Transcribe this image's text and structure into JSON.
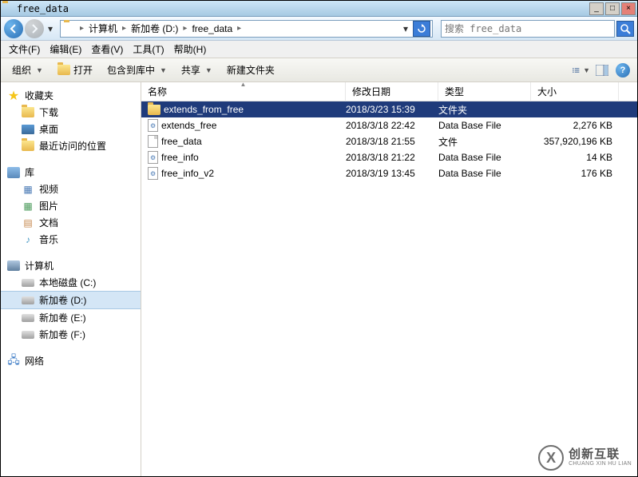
{
  "window": {
    "title": "free_data"
  },
  "titlebar_buttons": {
    "min": "_",
    "max": "□",
    "close": "×"
  },
  "breadcrumb": {
    "items": [
      "计算机",
      "新加卷 (D:)",
      "free_data"
    ]
  },
  "search": {
    "placeholder": "搜索 free_data"
  },
  "menus": [
    "文件(F)",
    "编辑(E)",
    "查看(V)",
    "工具(T)",
    "帮助(H)"
  ],
  "toolbar": {
    "organize": "组织",
    "open": "打开",
    "library": "包含到库中",
    "share": "共享",
    "newfolder": "新建文件夹"
  },
  "nav": {
    "favorites": {
      "label": "收藏夹",
      "items": [
        "下载",
        "桌面",
        "最近访问的位置"
      ]
    },
    "libraries": {
      "label": "库",
      "items": [
        "视频",
        "图片",
        "文档",
        "音乐"
      ]
    },
    "computer": {
      "label": "计算机",
      "items": [
        "本地磁盘 (C:)",
        "新加卷 (D:)",
        "新加卷 (E:)",
        "新加卷 (F:)"
      ]
    },
    "network": {
      "label": "网络"
    }
  },
  "columns": {
    "name": "名称",
    "date": "修改日期",
    "type": "类型",
    "size": "大小"
  },
  "files": [
    {
      "name": "extends_from_free",
      "date": "2018/3/23 15:39",
      "type": "文件夹",
      "size": "",
      "icon": "folder",
      "selected": true
    },
    {
      "name": "extends_free",
      "date": "2018/3/18 22:42",
      "type": "Data Base File",
      "size": "2,276 KB",
      "icon": "db"
    },
    {
      "name": "free_data",
      "date": "2018/3/18 21:55",
      "type": "文件",
      "size": "357,920,196 KB",
      "icon": "file"
    },
    {
      "name": "free_info",
      "date": "2018/3/18 21:22",
      "type": "Data Base File",
      "size": "14 KB",
      "icon": "db"
    },
    {
      "name": "free_info_v2",
      "date": "2018/3/19 13:45",
      "type": "Data Base File",
      "size": "176 KB",
      "icon": "db"
    }
  ],
  "watermark": {
    "cn": "创新互联",
    "en": "CHUANG XIN HU LIAN"
  }
}
